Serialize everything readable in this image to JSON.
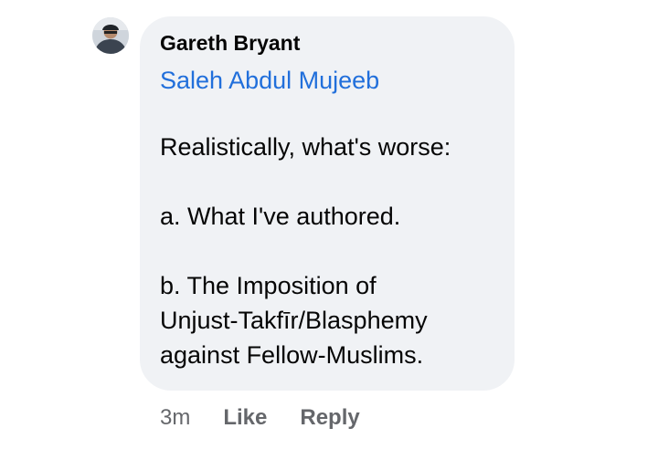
{
  "comment": {
    "author": "Gareth Bryant",
    "mention": "Saleh Abdul Mujeeb",
    "lines": [
      "Realistically, what's worse:",
      "a. What I've authored.",
      "b. The Imposition of",
      "Unjust-Takfīr/Blasphemy",
      "against Fellow-Muslims."
    ],
    "time": "3m",
    "like_label": "Like",
    "reply_label": "Reply"
  },
  "colors": {
    "bubble": "#f0f2f5",
    "mention": "#216fdb",
    "text": "#050505",
    "meta": "#65676b"
  }
}
